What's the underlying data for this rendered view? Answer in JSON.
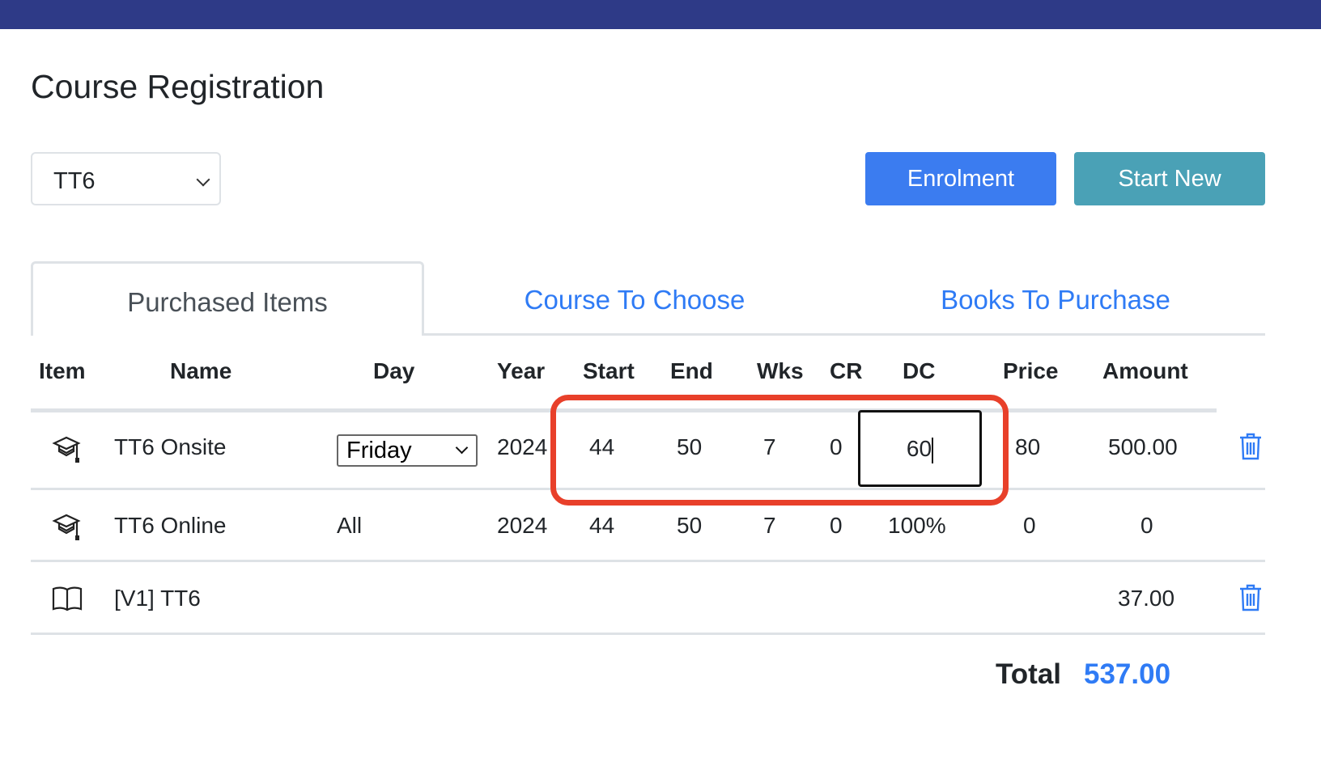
{
  "header": {
    "title": "Course Registration",
    "bar_color": "#2e3a87"
  },
  "course_select": {
    "value": "TT6"
  },
  "buttons": {
    "enrolment": "Enrolment",
    "start_new": "Start New"
  },
  "tabs": [
    {
      "label": "Purchased Items",
      "active": true
    },
    {
      "label": "Course To Choose",
      "active": false
    },
    {
      "label": "Books To Purchase",
      "active": false
    }
  ],
  "table": {
    "columns": [
      "Item",
      "Name",
      "Day",
      "Year",
      "Start",
      "End",
      "Wks",
      "CR",
      "DC",
      "Price",
      "Amount"
    ],
    "rows": [
      {
        "icon": "graduation-cap-icon",
        "name": "TT6 Onsite",
        "day": "Friday",
        "year": "2024",
        "start": "44",
        "end": "50",
        "wks": "7",
        "cr": "0",
        "dc": "60",
        "price": "80",
        "amount": "500.00",
        "deletable": true
      },
      {
        "icon": "graduation-cap-icon",
        "name": "TT6 Online",
        "day": "All",
        "year": "2024",
        "start": "44",
        "end": "50",
        "wks": "7",
        "cr": "0",
        "dc": "100%",
        "price": "0",
        "amount": "0",
        "deletable": false
      },
      {
        "icon": "book-icon",
        "name": "[V1] TT6",
        "amount": "37.00",
        "deletable": true
      }
    ]
  },
  "total": {
    "label": "Total",
    "value": "537.00",
    "color": "#2f7bf5"
  }
}
